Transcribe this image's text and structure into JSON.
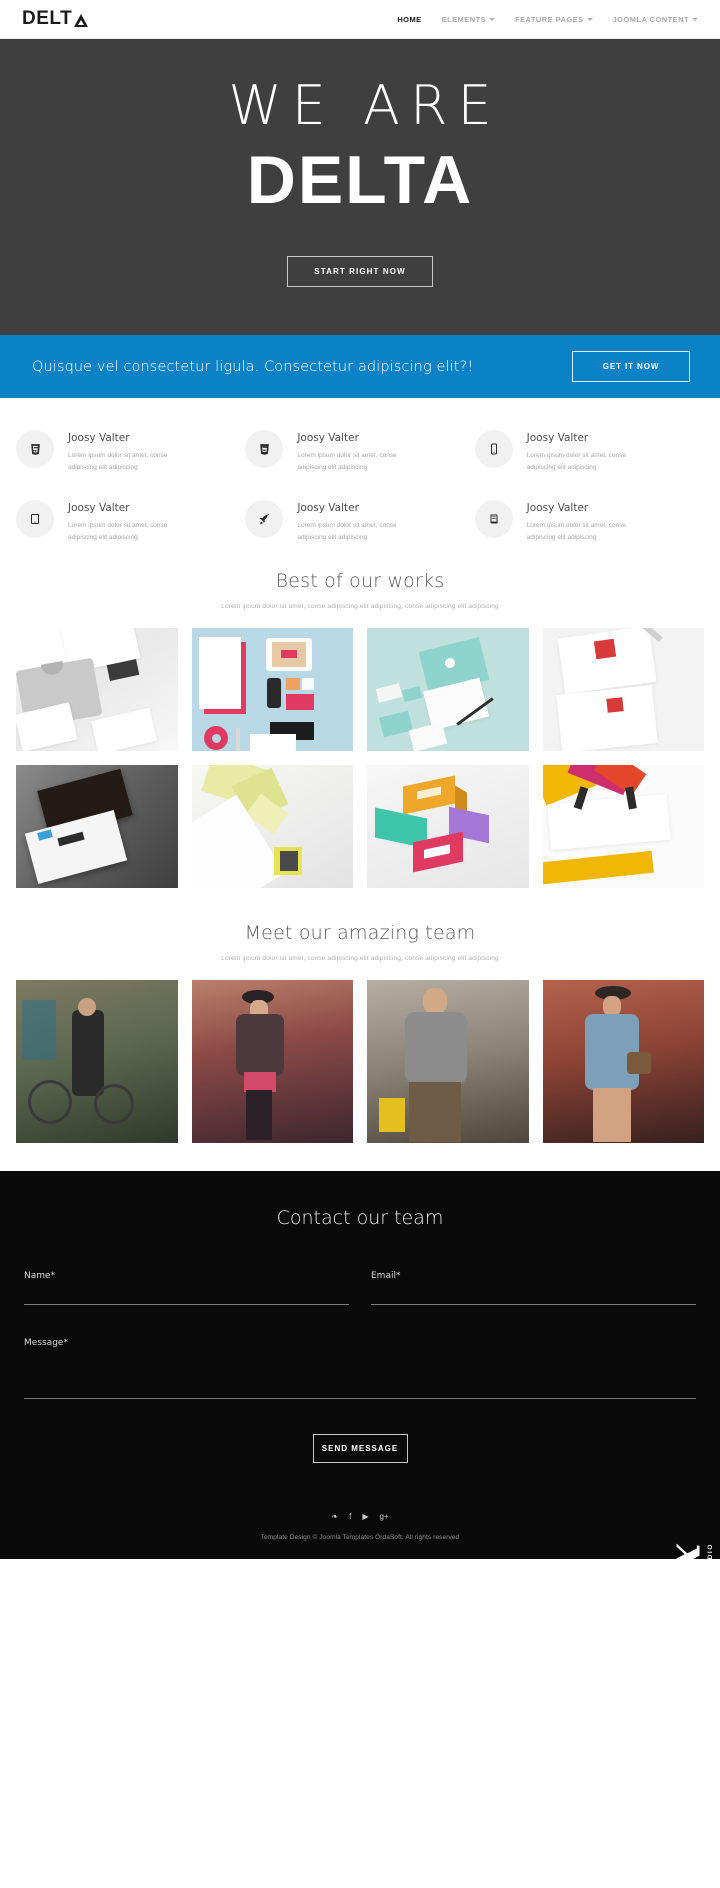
{
  "header": {
    "logo_text": "DELT",
    "logo_icon": "triangle-icon",
    "nav": [
      {
        "label": "HOME",
        "active": true,
        "has_caret": false
      },
      {
        "label": "ELEMENTS",
        "active": false,
        "has_caret": true
      },
      {
        "label": "FEATURE PAGES",
        "active": false,
        "has_caret": true
      },
      {
        "label": "JOOMLA CONTENT",
        "active": false,
        "has_caret": true
      }
    ]
  },
  "hero": {
    "line1": "WE ARE",
    "line2": "DELTA",
    "button": "START RIGHT NOW",
    "bg_color": "#3f3f3f"
  },
  "cta": {
    "text": "Quisque vel consectetur ligula. Consectetur adipiscing elit?!",
    "button": "GET IT NOW",
    "bg_color": "#0b81c6"
  },
  "features": [
    {
      "icon": "css3-icon",
      "title": "Joosy Valter",
      "desc": "Lorem ipsum dolor sit amet, conse adipiscing elit adipiscing"
    },
    {
      "icon": "html5-icon",
      "title": "Joosy Valter",
      "desc": "Lorem ipsum dolor sit amet, conse adipiscing elit adipiscing"
    },
    {
      "icon": "mobile-icon",
      "title": "Joosy Valter",
      "desc": "Lorem ipsum dolor sit amet, conse adipiscing elit adipiscing"
    },
    {
      "icon": "tablet-icon",
      "title": "Joosy Valter",
      "desc": "Lorem ipsum dolor sit amet, conse adipiscing elit adipiscing"
    },
    {
      "icon": "rocket-icon",
      "title": "Joosy Valter",
      "desc": "Lorem ipsum dolor sit amet, conse adipiscing elit adipiscing"
    },
    {
      "icon": "book-icon",
      "title": "Joosy Valter",
      "desc": "Lorem ipsum dolor sit amet, conse adipiscing elit adipiscing"
    }
  ],
  "works_section": {
    "title": "Best of our works",
    "subtitle": "Lorem ipsum dolor sit amet, conse adipiscing elit adipiscing, conse adipiscing elit adipiscing"
  },
  "works": [
    {
      "name": "grey-tshirt-stationery"
    },
    {
      "name": "pink-white-branding-set"
    },
    {
      "name": "mint-stationery-mockup"
    },
    {
      "name": "red-stamp-letterhead"
    },
    {
      "name": "dark-business-cards"
    },
    {
      "name": "yellow-folded-paper"
    },
    {
      "name": "colored-logo-boxes"
    },
    {
      "name": "magenta-yellow-envelope"
    }
  ],
  "team_section": {
    "title": "Meet our amazing team",
    "subtitle": "Lorem ipsum dolor sit amet, conse adipiscing elit adipiscing, conse adipiscing elit adipiscing"
  },
  "team": [
    {
      "name": "bearded-man-bicycle"
    },
    {
      "name": "woman-hat-bridge"
    },
    {
      "name": "man-grey-sweater"
    },
    {
      "name": "woman-denim-dress"
    }
  ],
  "contact": {
    "title": "Contact our team",
    "name_label": "Name*",
    "name_value": "",
    "name_placeholder": "",
    "email_label": "Email*",
    "email_value": "",
    "email_placeholder": "",
    "message_label": "Message*",
    "message_value": "",
    "message_placeholder": "",
    "send_button": "SEND MESSAGE"
  },
  "footer": {
    "social": [
      {
        "icon": "twitter-icon",
        "glyph": "❧"
      },
      {
        "icon": "facebook-icon",
        "glyph": "f"
      },
      {
        "icon": "youtube-icon",
        "glyph": "▶"
      },
      {
        "icon": "google-plus-icon",
        "glyph": "g+"
      }
    ],
    "copyright": "Template Design © Joomla Templates OrdaSoft. All rights reserved"
  },
  "watermark": {
    "brand": "JoomFox",
    "tagline": "CREATIVE WEB STUDIO"
  }
}
